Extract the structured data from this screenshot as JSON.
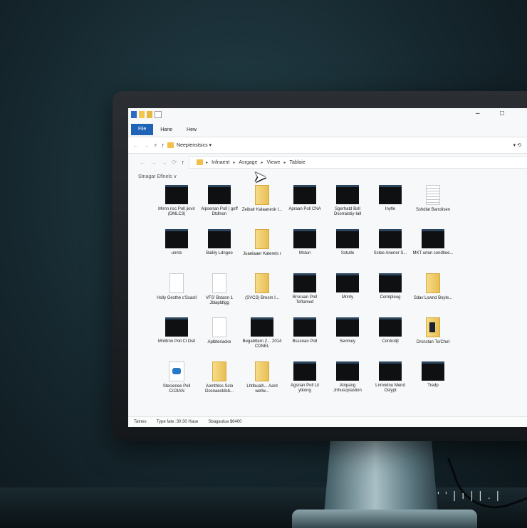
{
  "quick_access": [
    "icon",
    "icon",
    "icon",
    "dropdown"
  ],
  "window_controls": {
    "minimize": "–",
    "maximize": "□"
  },
  "ribbon": {
    "file": "File",
    "home": "Hane",
    "view": "Hew"
  },
  "address_bar": {
    "path": "Neepienstsics ▾",
    "right_icons": "▾  ⟲"
  },
  "breadcrumb": [
    "Infnaent",
    "Asrgage",
    "Viewe",
    "Tablaie"
  ],
  "section_label": "Stnagar Eflnels ∨",
  "items": [
    {
      "label": "Mnnn nsc Poll jiovir (DMLC3)",
      "icon": "folder-dark"
    },
    {
      "label": "Alpsenan Poll | goff Dtdlnon",
      "icon": "folder-dark"
    },
    {
      "label": "Zeibalr Kalaanesk I...",
      "icon": "folder-yellow"
    },
    {
      "label": "Apraan Poll CNA",
      "icon": "folder-dark"
    },
    {
      "label": "Sgerhatd Bsll Dsorralstiy-Iall",
      "icon": "folder-dark"
    },
    {
      "label": "Inytle",
      "icon": "folder-dark"
    },
    {
      "label": "Sshdlat Banolisen",
      "icon": "doc-lines"
    },
    {
      "label": "unnts",
      "icon": "folder-dark"
    },
    {
      "label": "Bailiiy Ldngoo",
      "icon": "folder-dark"
    },
    {
      "label": "Juaeiaaer Katerels r",
      "icon": "folder-yellow"
    },
    {
      "label": "Mstun",
      "icon": "folder-dark"
    },
    {
      "label": "Sstutle",
      "icon": "folder-dark"
    },
    {
      "label": "Sstee Anener S...",
      "icon": "folder-dark"
    },
    {
      "label": "MKT urlan condtioe...",
      "icon": "folder-dark"
    },
    {
      "label": "Hslly Gesthe c'Ssasll",
      "icon": "doc"
    },
    {
      "label": "VFS' Bstann 1 Jblapldtgg",
      "icon": "doc"
    },
    {
      "label": "(SVCS) Bresm I...",
      "icon": "folder-yellow"
    },
    {
      "label": "Brsnaan Poll Teftamed",
      "icon": "folder-dark"
    },
    {
      "label": "Mnnty",
      "icon": "folder-dark"
    },
    {
      "label": "Comtpleug",
      "icon": "folder-dark"
    },
    {
      "label": "Sdav Lswnd Boyle...",
      "icon": "folder-yellow"
    },
    {
      "label": "Mniltrnn Poll Cl Dsit",
      "icon": "folder-dark"
    },
    {
      "label": "Aplbteriacke",
      "icon": "doc"
    },
    {
      "label": "Begabttern Z... 2014 CDNEL",
      "icon": "folder-dark"
    },
    {
      "label": "Bsssnan Poll",
      "icon": "folder-dark"
    },
    {
      "label": "Senmey",
      "icon": "folder-dark"
    },
    {
      "label": "Controlljl",
      "icon": "folder-dark"
    },
    {
      "label": "Drsnstan To/Chet",
      "icon": "folder-pic"
    },
    {
      "label": "Stecienee Poll Ci:DtAN",
      "icon": "doc-blue"
    },
    {
      "label": "Aontthlos Sclo Dosnaestdsb...",
      "icon": "folder-yellow"
    },
    {
      "label": "Lhtlbualh... Aard wellw...",
      "icon": "folder-yellow"
    },
    {
      "label": "Agsnan Poll Lil ytkong",
      "icon": "folder-dark"
    },
    {
      "label": "Atnpang Jnhuscptasiion",
      "icon": "folder-dark"
    },
    {
      "label": "Lnmndnu Mend Oslypt",
      "icon": "folder-dark"
    },
    {
      "label": "Tredp",
      "icon": "folder-dark"
    }
  ],
  "status_bar": {
    "items": "Tatnes",
    "type": "Type fate :30:30 Hase",
    "size": "Sbagaulua $6400"
  },
  "watermark": "' ' | ı | | . |"
}
